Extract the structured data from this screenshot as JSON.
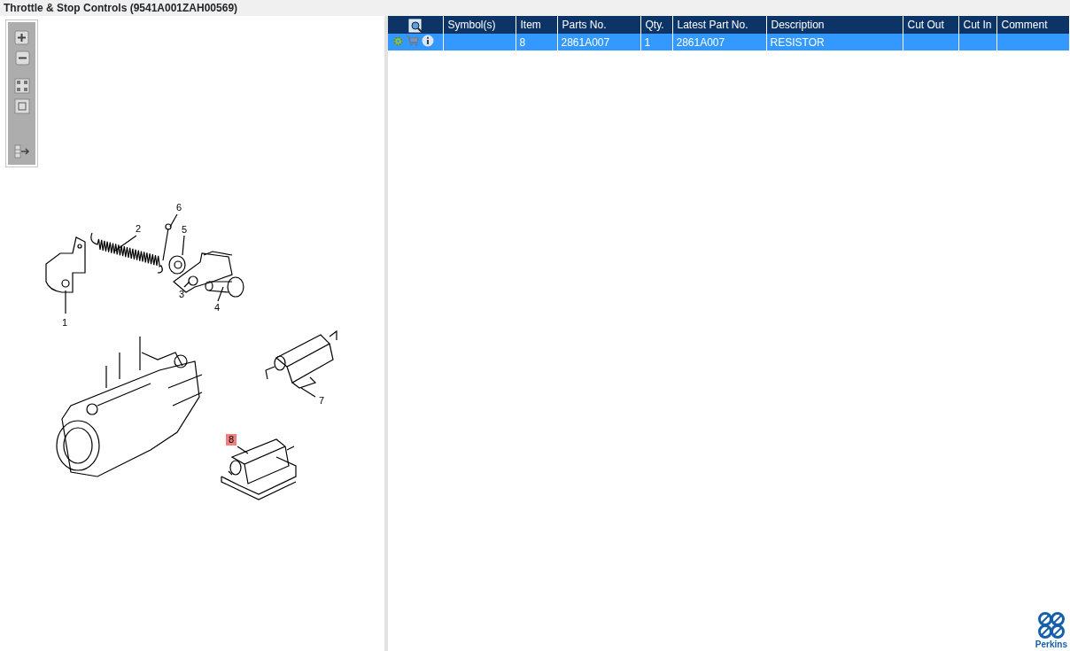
{
  "window": {
    "title": "Throttle & Stop Controls (9541A001ZAH00569)"
  },
  "diagram": {
    "callouts": [
      {
        "label": "1",
        "selected": false
      },
      {
        "label": "2",
        "selected": false
      },
      {
        "label": "3",
        "selected": false
      },
      {
        "label": "4",
        "selected": false
      },
      {
        "label": "5",
        "selected": false
      },
      {
        "label": "6",
        "selected": false
      },
      {
        "label": "7",
        "selected": false
      },
      {
        "label": "8",
        "selected": true
      }
    ]
  },
  "table": {
    "columns": [
      "Symbol(s)",
      "Item",
      "Parts No.",
      "Qty.",
      "Latest Part No.",
      "Description",
      "Cut Out",
      "Cut In",
      "Comment"
    ],
    "rows": [
      {
        "selected": true,
        "cells": [
          null,
          "8",
          "2861A007",
          "1",
          "2861A007",
          "RESISTOR",
          null,
          null,
          null
        ]
      }
    ]
  },
  "logo": {
    "text": "Perkins"
  }
}
